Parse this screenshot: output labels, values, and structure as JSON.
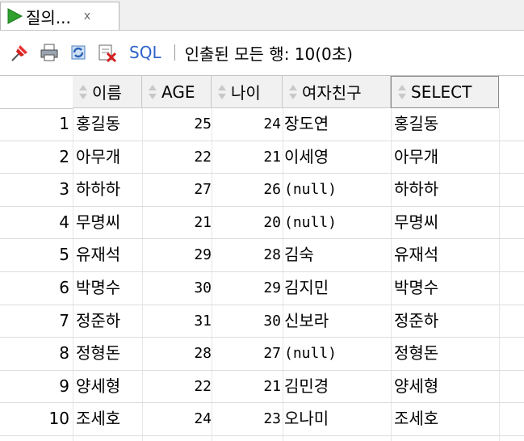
{
  "tab": {
    "label": "질의...",
    "close": "x"
  },
  "toolbar": {
    "sql_label": "SQL",
    "separator": "|",
    "status": "인출된 모든 행: 10(0초)"
  },
  "columns": [
    "이름",
    "AGE",
    "나이",
    "여자친구",
    "SELECT"
  ],
  "rows": [
    {
      "num": "1",
      "name": "홍길동",
      "age": "25",
      "nai": "24",
      "gf": "장도연",
      "sel": "홍길동"
    },
    {
      "num": "2",
      "name": "아무개",
      "age": "22",
      "nai": "21",
      "gf": "이세영",
      "sel": "아무개"
    },
    {
      "num": "3",
      "name": "하하하",
      "age": "27",
      "nai": "26",
      "gf": "(null)",
      "sel": "하하하"
    },
    {
      "num": "4",
      "name": "무명씨",
      "age": "21",
      "nai": "20",
      "gf": "(null)",
      "sel": "무명씨"
    },
    {
      "num": "5",
      "name": "유재석",
      "age": "29",
      "nai": "28",
      "gf": "김숙",
      "sel": "유재석"
    },
    {
      "num": "6",
      "name": "박명수",
      "age": "30",
      "nai": "29",
      "gf": "김지민",
      "sel": "박명수"
    },
    {
      "num": "7",
      "name": "정준하",
      "age": "31",
      "nai": "30",
      "gf": "신보라",
      "sel": "정준하"
    },
    {
      "num": "8",
      "name": "정형돈",
      "age": "28",
      "nai": "27",
      "gf": "(null)",
      "sel": "정형돈"
    },
    {
      "num": "9",
      "name": "양세형",
      "age": "22",
      "nai": "21",
      "gf": "김민경",
      "sel": "양세형"
    },
    {
      "num": "10",
      "name": "조세호",
      "age": "24",
      "nai": "23",
      "gf": "오나미",
      "sel": "조세호"
    }
  ],
  "colors": {
    "sql_link": "#2f63c8",
    "run_icon": "#2ea02e",
    "pin_icon": "#d42020",
    "header_bg": "#f1f1f1"
  }
}
